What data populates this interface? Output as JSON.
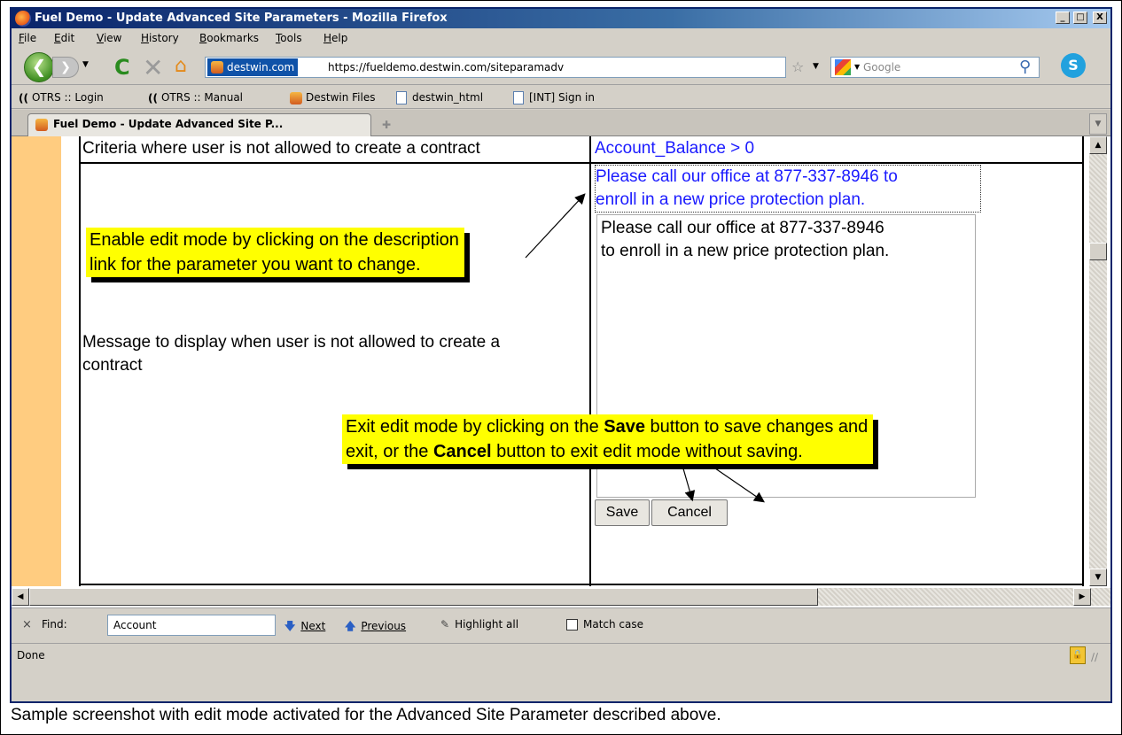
{
  "window": {
    "title": "Fuel Demo - Update Advanced Site Parameters - Mozilla Firefox",
    "min_glyph": "_",
    "max_glyph": "□",
    "close_glyph": "X"
  },
  "menu": [
    "File",
    "Edit",
    "View",
    "History",
    "Bookmarks",
    "Tools",
    "Help"
  ],
  "toolbar": {
    "site_identity": "destwin.com",
    "url": "https://fueldemo.destwin.com/siteparamadv",
    "search_placeholder": "Google"
  },
  "bookmarks": [
    {
      "label": "OTRS :: Login",
      "icon": "otrs-icon"
    },
    {
      "label": "OTRS :: Manual",
      "icon": "otrs-icon"
    },
    {
      "label": "Destwin Files",
      "icon": "destwin-icon"
    },
    {
      "label": "destwin_html",
      "icon": "page-icon"
    },
    {
      "label": "[INT] Sign in",
      "icon": "page-icon"
    }
  ],
  "tab": {
    "label": "Fuel Demo - Update Advanced Site P..."
  },
  "page": {
    "row1_label": "Criteria where user is not allowed to create a contract",
    "row1_value": "Account_Balance > 0",
    "row2_label_line1": "Message to display when user is not allowed to create a",
    "row2_label_line2": "contract",
    "row2_link_line1": "Please call our office at 877-337-8946 to",
    "row2_link_line2": "enroll in a new price protection plan.",
    "row2_textarea_line1": "Please call our office at 877-337-8946",
    "row2_textarea_line2": "to enroll in a new price protection plan.",
    "save_label": "Save",
    "cancel_label": "Cancel"
  },
  "callouts": {
    "edit_line1": "Enable edit mode by clicking on the description",
    "edit_line2": "link for the parameter you want to change.",
    "exit_line1_a": "Exit edit mode by clicking on the ",
    "exit_line1_b": "Save",
    "exit_line1_c": " button to save changes and",
    "exit_line2_a": "exit, or the ",
    "exit_line2_b": "Cancel",
    "exit_line2_c": " button to exit edit mode without saving."
  },
  "findbar": {
    "close_glyph": "×",
    "label": "Find:",
    "value": "Account",
    "next": "Next",
    "previous": "Previous",
    "highlight": "Highlight all",
    "match_case": "Match case"
  },
  "status": {
    "text": "Done"
  },
  "caption": "Sample screenshot with edit mode activated for the Advanced Site Parameter described above."
}
